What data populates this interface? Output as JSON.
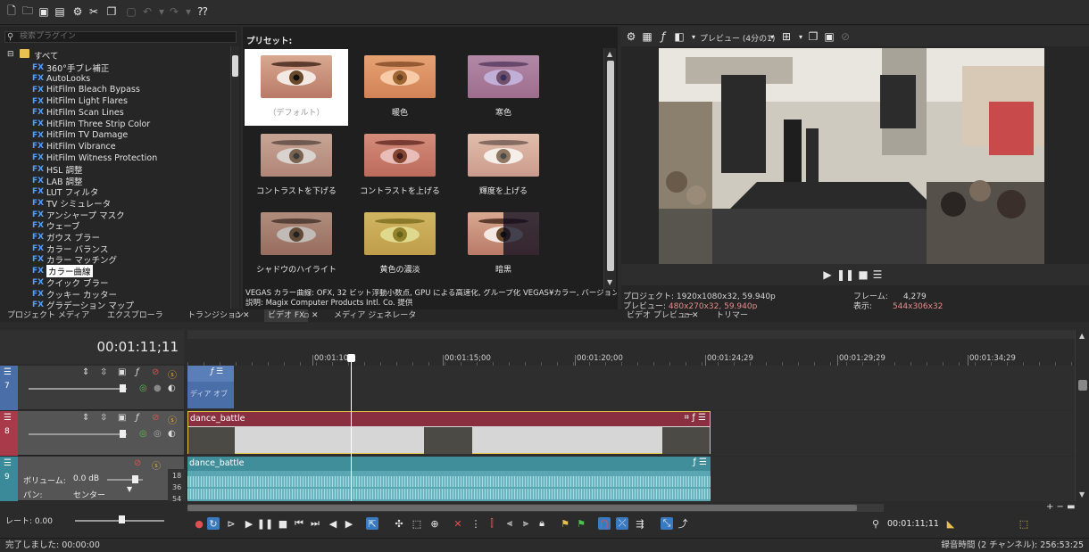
{
  "toolbar": {
    "icons": [
      "new-file-icon",
      "open-folder-icon",
      "save-icon",
      "save-as-icon",
      "settings-gear-icon",
      "scissors-icon",
      "copy-icon",
      "paste-icon",
      "undo-icon",
      "redo-icon",
      "help-icon"
    ]
  },
  "plugins": {
    "search_placeholder": "検索プラグイン",
    "root": "すべて",
    "items": [
      "360°手ブレ補正",
      "AutoLooks",
      "HitFilm Bleach Bypass",
      "HitFilm Light Flares",
      "HitFilm Scan Lines",
      "HitFilm Three Strip Color",
      "HitFilm TV Damage",
      "HitFilm Vibrance",
      "HitFilm Witness Protection",
      "HSL 調整",
      "LAB 調整",
      "LUT フィルタ",
      "TV シミュレータ",
      "アンシャープ マスク",
      "ウェーブ",
      "ガウス ブラー",
      "カラー バランス",
      "カラー マッチング",
      "カラー曲線",
      "クイック ブラー",
      "クッキー カッター",
      "グラデーション マップ"
    ],
    "selected": "カラー曲線",
    "fx_badge": "FX"
  },
  "presets": {
    "title": "プリセット:",
    "items": [
      "（デフォルト）",
      "暖色",
      "寒色",
      "コントラストを下げる",
      "コントラストを上げる",
      "輝度を上げる",
      "シャドウのハイライト",
      "黄色の濃淡",
      "暗黒"
    ],
    "description": "VEGAS カラー曲線: OFX, 32 ビット浮動小数点, GPU による高速化, グループ化 VEGAS¥カラー, バージョン",
    "description2": "説明: Magix Computer Products Intl. Co. 提供"
  },
  "preview": {
    "mode": "プレビュー (4分の1)",
    "project_label": "プロジェクト:",
    "project_value": "1920x1080x32, 59.940p",
    "preview_label": "プレビュー:",
    "preview_value": "480x270x32, 59.940p",
    "frame_label": "フレーム:",
    "frame_value": "4,279",
    "display_label": "表示:",
    "display_value": "544x306x32"
  },
  "tabs": {
    "project_media": "プロジェクト メディア",
    "explorer": "エクスプローラ",
    "transitions": "トランジション",
    "video_fx": "ビデオ FX",
    "media_generator": "メディア ジェネレータ",
    "video_preview": "ビデオ プレビュー",
    "trimmer": "トリマー"
  },
  "timeline": {
    "timecode": "00:01:11;11",
    "ruler": [
      "00:01:10",
      "00:01:15;00",
      "00:01:20;00",
      "00:01:24;29",
      "00:01:29;29",
      "00:01:34;29"
    ],
    "tracks": [
      {
        "num": "7",
        "clip": "ディア オブ"
      },
      {
        "num": "8",
        "clip": "dance_battle"
      },
      {
        "num": "9",
        "clip": "dance_battle",
        "volume_label": "ボリューム:",
        "volume_value": "0.0 dB",
        "pan_label": "パン:",
        "pan_value": "センター"
      }
    ],
    "meter": [
      "18",
      "36",
      "54"
    ],
    "rate_label": "レート: 0.00",
    "cursor_time": "00:01:11;11"
  },
  "status": {
    "left": "完了しました: 00:00:00",
    "right": "録音時間 (2 チャンネル): 256:53:25"
  }
}
